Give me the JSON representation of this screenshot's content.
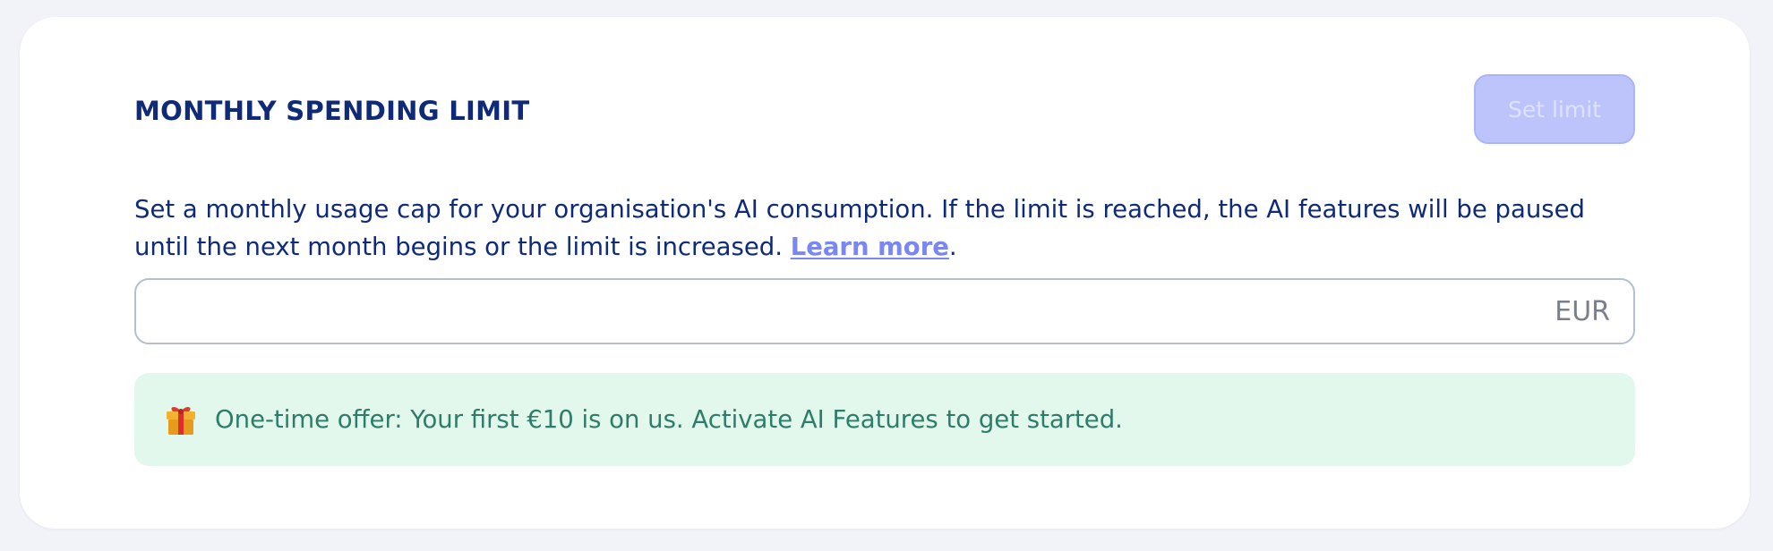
{
  "section": {
    "title": "MONTHLY SPENDING LIMIT",
    "set_limit_label": "Set limit",
    "description_text": "Set a monthly usage cap for your organisation's AI consumption. If the limit is reached, the AI features will be paused until the next month begins or the limit is increased. ",
    "learn_more_label": "Learn more",
    "description_end": "."
  },
  "limit_input": {
    "value": "",
    "currency": "EUR"
  },
  "offer": {
    "icon": "gift-icon",
    "text": "One-time offer: Your first €10 is on us. Activate AI Features to get started."
  },
  "colors": {
    "heading": "#0e2a78",
    "button_disabled": "#bcc4fb",
    "link": "#7a86f2",
    "offer_background": "#e3f8ec",
    "offer_text": "#2e7c6a"
  }
}
